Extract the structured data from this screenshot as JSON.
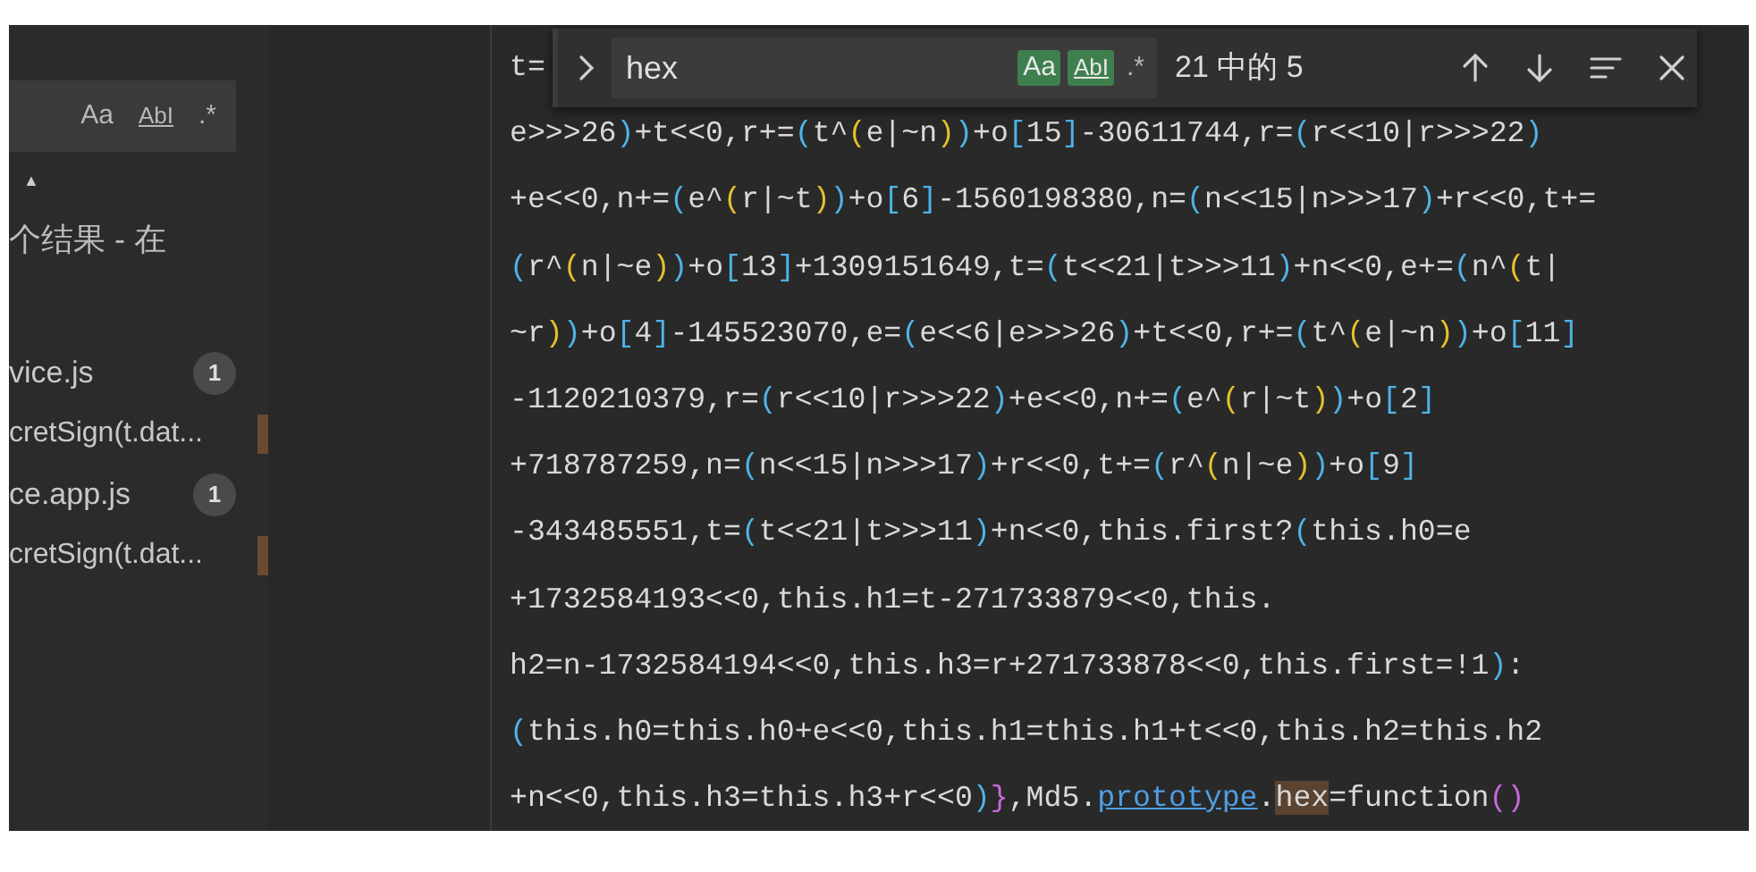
{
  "sidebar": {
    "options": [
      {
        "label": "Aa",
        "on": false
      },
      {
        "label": "AbI",
        "on": false
      },
      {
        "label": ".*",
        "on": false
      }
    ],
    "arrow": "▲",
    "summary": "个结果 - 在",
    "items": [
      {
        "kind": "file",
        "label": "vice.js",
        "count": "1"
      },
      {
        "kind": "match",
        "label": "cretSign(t.dat..."
      },
      {
        "kind": "file",
        "label": "ce.app.js",
        "count": "1"
      },
      {
        "kind": "match",
        "label": "cretSign(t.dat..."
      }
    ]
  },
  "find": {
    "value": "hex",
    "options": [
      {
        "label": "Aa",
        "on": true
      },
      {
        "label": "AbI",
        "on": true
      },
      {
        "label": ".*",
        "on": false
      }
    ],
    "result": "21 中的 5"
  },
  "code": [
    [
      {
        "text": "t=",
        "kind": "plain"
      }
    ],
    [
      {
        "text": "e>>>26",
        "kind": "plain"
      },
      {
        "text": ")",
        "kind": "p1"
      },
      {
        "text": "+t<<0,r+=",
        "kind": "plain"
      },
      {
        "text": "(",
        "kind": "p1"
      },
      {
        "text": "t^",
        "kind": "plain"
      },
      {
        "text": "(",
        "kind": "p2"
      },
      {
        "text": "e|~n",
        "kind": "plain"
      },
      {
        "text": ")",
        "kind": "p2"
      },
      {
        "text": ")",
        "kind": "p1"
      },
      {
        "text": "+o",
        "kind": "plain"
      },
      {
        "text": "[",
        "kind": "p1"
      },
      {
        "text": "15",
        "kind": "plain"
      },
      {
        "text": "]",
        "kind": "p1"
      },
      {
        "text": "-30611744,r=",
        "kind": "plain"
      },
      {
        "text": "(",
        "kind": "p1"
      },
      {
        "text": "r<<10|r>>>22",
        "kind": "plain"
      },
      {
        "text": ")",
        "kind": "p1"
      }
    ],
    [
      {
        "text": "+e<<0,n+=",
        "kind": "plain"
      },
      {
        "text": "(",
        "kind": "p1"
      },
      {
        "text": "e^",
        "kind": "plain"
      },
      {
        "text": "(",
        "kind": "p2"
      },
      {
        "text": "r|~t",
        "kind": "plain"
      },
      {
        "text": ")",
        "kind": "p2"
      },
      {
        "text": ")",
        "kind": "p1"
      },
      {
        "text": "+o",
        "kind": "plain"
      },
      {
        "text": "[",
        "kind": "p1"
      },
      {
        "text": "6",
        "kind": "plain"
      },
      {
        "text": "]",
        "kind": "p1"
      },
      {
        "text": "-1560198380,n=",
        "kind": "plain"
      },
      {
        "text": "(",
        "kind": "p1"
      },
      {
        "text": "n<<15|n>>>17",
        "kind": "plain"
      },
      {
        "text": ")",
        "kind": "p1"
      },
      {
        "text": "+r<<0,t+=",
        "kind": "plain"
      }
    ],
    [
      {
        "text": "(",
        "kind": "p1"
      },
      {
        "text": "r^",
        "kind": "plain"
      },
      {
        "text": "(",
        "kind": "p2"
      },
      {
        "text": "n|~e",
        "kind": "plain"
      },
      {
        "text": ")",
        "kind": "p2"
      },
      {
        "text": ")",
        "kind": "p1"
      },
      {
        "text": "+o",
        "kind": "plain"
      },
      {
        "text": "[",
        "kind": "p1"
      },
      {
        "text": "13",
        "kind": "plain"
      },
      {
        "text": "]",
        "kind": "p1"
      },
      {
        "text": "+1309151649,t=",
        "kind": "plain"
      },
      {
        "text": "(",
        "kind": "p1"
      },
      {
        "text": "t<<21|t>>>11",
        "kind": "plain"
      },
      {
        "text": ")",
        "kind": "p1"
      },
      {
        "text": "+n<<0,e+=",
        "kind": "plain"
      },
      {
        "text": "(",
        "kind": "p1"
      },
      {
        "text": "n^",
        "kind": "plain"
      },
      {
        "text": "(",
        "kind": "p2"
      },
      {
        "text": "t|",
        "kind": "plain"
      }
    ],
    [
      {
        "text": "~r",
        "kind": "plain"
      },
      {
        "text": ")",
        "kind": "p2"
      },
      {
        "text": ")",
        "kind": "p1"
      },
      {
        "text": "+o",
        "kind": "plain"
      },
      {
        "text": "[",
        "kind": "p1"
      },
      {
        "text": "4",
        "kind": "plain"
      },
      {
        "text": "]",
        "kind": "p1"
      },
      {
        "text": "-145523070,e=",
        "kind": "plain"
      },
      {
        "text": "(",
        "kind": "p1"
      },
      {
        "text": "e<<6|e>>>26",
        "kind": "plain"
      },
      {
        "text": ")",
        "kind": "p1"
      },
      {
        "text": "+t<<0,r+=",
        "kind": "plain"
      },
      {
        "text": "(",
        "kind": "p1"
      },
      {
        "text": "t^",
        "kind": "plain"
      },
      {
        "text": "(",
        "kind": "p2"
      },
      {
        "text": "e|~n",
        "kind": "plain"
      },
      {
        "text": ")",
        "kind": "p2"
      },
      {
        "text": ")",
        "kind": "p1"
      },
      {
        "text": "+o",
        "kind": "plain"
      },
      {
        "text": "[",
        "kind": "p1"
      },
      {
        "text": "11",
        "kind": "plain"
      },
      {
        "text": "]",
        "kind": "p1"
      }
    ],
    [
      {
        "text": "-1120210379,r=",
        "kind": "plain"
      },
      {
        "text": "(",
        "kind": "p1"
      },
      {
        "text": "r<<10|r>>>22",
        "kind": "plain"
      },
      {
        "text": ")",
        "kind": "p1"
      },
      {
        "text": "+e<<0,n+=",
        "kind": "plain"
      },
      {
        "text": "(",
        "kind": "p1"
      },
      {
        "text": "e^",
        "kind": "plain"
      },
      {
        "text": "(",
        "kind": "p2"
      },
      {
        "text": "r|~t",
        "kind": "plain"
      },
      {
        "text": ")",
        "kind": "p2"
      },
      {
        "text": ")",
        "kind": "p1"
      },
      {
        "text": "+o",
        "kind": "plain"
      },
      {
        "text": "[",
        "kind": "p1"
      },
      {
        "text": "2",
        "kind": "plain"
      },
      {
        "text": "]",
        "kind": "p1"
      }
    ],
    [
      {
        "text": "+718787259,n=",
        "kind": "plain"
      },
      {
        "text": "(",
        "kind": "p1"
      },
      {
        "text": "n<<15|n>>>17",
        "kind": "plain"
      },
      {
        "text": ")",
        "kind": "p1"
      },
      {
        "text": "+r<<0,t+=",
        "kind": "plain"
      },
      {
        "text": "(",
        "kind": "p1"
      },
      {
        "text": "r^",
        "kind": "plain"
      },
      {
        "text": "(",
        "kind": "p2"
      },
      {
        "text": "n|~e",
        "kind": "plain"
      },
      {
        "text": ")",
        "kind": "p2"
      },
      {
        "text": ")",
        "kind": "p1"
      },
      {
        "text": "+o",
        "kind": "plain"
      },
      {
        "text": "[",
        "kind": "p1"
      },
      {
        "text": "9",
        "kind": "plain"
      },
      {
        "text": "]",
        "kind": "p1"
      }
    ],
    [
      {
        "text": "-343485551,t=",
        "kind": "plain"
      },
      {
        "text": "(",
        "kind": "p1"
      },
      {
        "text": "t<<21|t>>>11",
        "kind": "plain"
      },
      {
        "text": ")",
        "kind": "p1"
      },
      {
        "text": "+n<<0,this.first?",
        "kind": "plain"
      },
      {
        "text": "(",
        "kind": "p1"
      },
      {
        "text": "this.h0=e",
        "kind": "plain"
      }
    ],
    [
      {
        "text": "+1732584193<<0,this.h1=t-271733879<<0,this.",
        "kind": "plain"
      }
    ],
    [
      {
        "text": "h2=n-1732584194<<0,this.h3=r+271733878<<0,this.first=!1",
        "kind": "plain"
      },
      {
        "text": ")",
        "kind": "p1"
      },
      {
        "text": ":",
        "kind": "plain"
      }
    ],
    [
      {
        "text": "(",
        "kind": "p1"
      },
      {
        "text": "this.h0=this.h0+e<<0,this.h1=this.h1+t<<0,this.h2=this.h2",
        "kind": "plain"
      }
    ],
    [
      {
        "text": "+n<<0,this.h3=this.h3+r<<0",
        "kind": "plain"
      },
      {
        "text": ")",
        "kind": "p1"
      },
      {
        "text": "}",
        "kind": "p3"
      },
      {
        "text": ",Md5.",
        "kind": "plain"
      },
      {
        "text": "prototype",
        "kind": "link"
      },
      {
        "text": ".",
        "kind": "plain"
      },
      {
        "text": "hex",
        "kind": "match"
      },
      {
        "text": "=function",
        "kind": "plain"
      },
      {
        "text": "()",
        "kind": "p3"
      }
    ]
  ]
}
